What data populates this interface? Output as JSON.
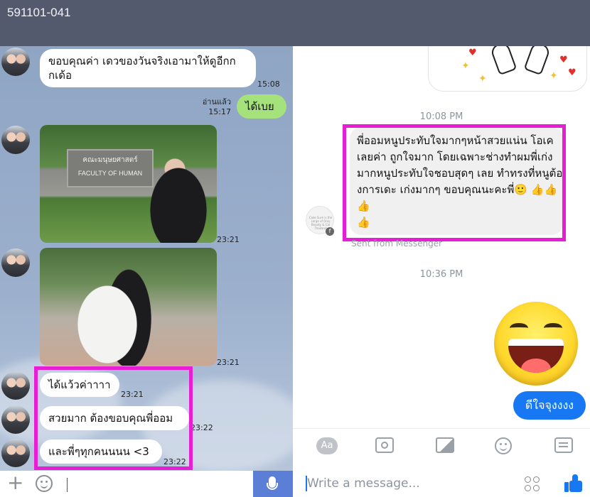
{
  "header": {
    "code": "591101-041"
  },
  "line_chat": {
    "messages": [
      {
        "text": "ขอบคุณค่า เดวของวันจริงเอามาให้ดูอีกก\nกเด้อ",
        "time": "15:08"
      },
      {
        "text": "ได้เบย",
        "read": "อ่านแล้ว",
        "time": "15:17"
      },
      {
        "time": "23:21"
      },
      {
        "time": "23:21"
      },
      {
        "text": "ได้แว้วค่าาาา",
        "time": "23:21"
      },
      {
        "text": "สวยมาก ต้องขอบคุณพี่ออม",
        "time": "23:22"
      },
      {
        "text": "และพี่ๆทุกคนนนน <3",
        "time": "23:22"
      }
    ],
    "photo1_sign": "FACULTY OF HUMAN",
    "photo1_sign_thai": "คณะมนุษยศาสตร์",
    "input": {
      "plus": "+"
    }
  },
  "messenger": {
    "timestamp_1": "10:08 PM",
    "message": "พี่ออมหนูประทับใจมากๆหน้าสวยแน่น โอเคเลยค่า ถูกใจมาก โดยเฉพาะช่างทำผมพี่เก่งมากหนูประทับใจชอบสุดๆ เลย ทำทรงที่หนูต้องการเดะ เก่งมากๆ ขอบคุณนะคะพี่",
    "message_emoji": "🙂",
    "thumbs": "👍👍👍",
    "thumbs_line2": "👍",
    "sender_avatar_text": "Cake Sure is the Large of Only Beauty & Cal Thailand",
    "fb_badge": "f",
    "sent_from": "Sent from Messenger",
    "timestamp_2": "10:36 PM",
    "outgoing": "ดีใจจุงงงง",
    "toolbar": {
      "aa": "Aa"
    },
    "composer_placeholder": "Write a message..."
  },
  "colors": {
    "highlight": "#e81ed7",
    "messenger_blue": "#1877f2",
    "line_green": "#a6e27c",
    "header_bg": "#535a6e"
  }
}
